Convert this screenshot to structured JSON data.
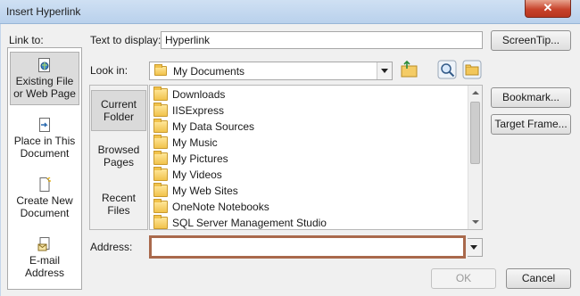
{
  "window": {
    "title": "Insert Hyperlink",
    "close_glyph": "✕"
  },
  "link_to": {
    "label": "Link to:",
    "items": [
      {
        "line1": "Existing File",
        "line2": "or Web Page",
        "icon": "web-page-icon",
        "selected": true
      },
      {
        "line1": "Place in This",
        "line2": "Document",
        "icon": "place-in-document-icon"
      },
      {
        "line1": "Create New",
        "line2": "Document",
        "icon": "new-document-icon"
      },
      {
        "line1": "E-mail",
        "line2": "Address",
        "icon": "email-icon"
      }
    ]
  },
  "text_to_display": {
    "label": "Text to display:",
    "value": "Hyperlink"
  },
  "screentip_label": "ScreenTip...",
  "look_in": {
    "label": "Look in:",
    "value": "My Documents",
    "icons": [
      "folder-icon",
      "up-folder-icon",
      "browse-web-icon",
      "browse-file-icon"
    ]
  },
  "nav": {
    "items": [
      {
        "line1": "Current",
        "line2": "Folder",
        "selected": true
      },
      {
        "line1": "Browsed",
        "line2": "Pages"
      },
      {
        "line1": "Recent",
        "line2": "Files"
      }
    ]
  },
  "files": [
    {
      "name": "Downloads",
      "icon": "folder-icon"
    },
    {
      "name": "IISExpress",
      "icon": "folder-icon"
    },
    {
      "name": "My Data Sources",
      "icon": "data-sources-folder-icon"
    },
    {
      "name": "My Music",
      "icon": "music-folder-icon"
    },
    {
      "name": "My Pictures",
      "icon": "pictures-folder-icon"
    },
    {
      "name": "My Videos",
      "icon": "folder-icon"
    },
    {
      "name": "My Web Sites",
      "icon": "web-sites-folder-icon"
    },
    {
      "name": "OneNote Notebooks",
      "icon": "folder-icon"
    },
    {
      "name": "SQL Server Management Studio",
      "icon": "folder-icon"
    }
  ],
  "side_buttons": {
    "bookmark": "Bookmark...",
    "target_frame": "Target Frame..."
  },
  "address": {
    "label": "Address:",
    "value": ""
  },
  "footer": {
    "ok": "OK",
    "cancel": "Cancel"
  },
  "colors": {
    "address_highlight": "#a9694c",
    "close_button": "#c7432b"
  }
}
